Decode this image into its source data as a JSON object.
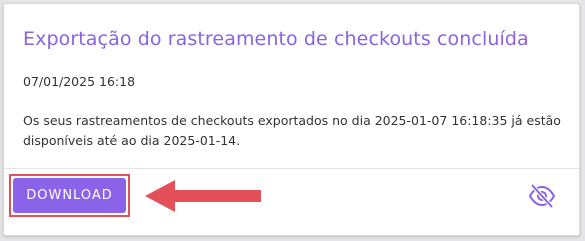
{
  "notification": {
    "title": "Exportação do rastreamento de checkouts concluída",
    "datetime": "07/01/2025 16:18",
    "message": "Os seus rastreamentos de checkouts exportados no dia 2025-01-07 16:18:35 já estão disponíveis até ao dia 2025-01-14."
  },
  "actions": {
    "download_label": "DOWNLOAD",
    "hide_icon": "eye-off-icon"
  },
  "annotation": {
    "arrow_icon": "arrow-left-icon",
    "color": "#e4505a"
  },
  "colors": {
    "accent": "#8a63e8",
    "title": "#8a63e0"
  }
}
